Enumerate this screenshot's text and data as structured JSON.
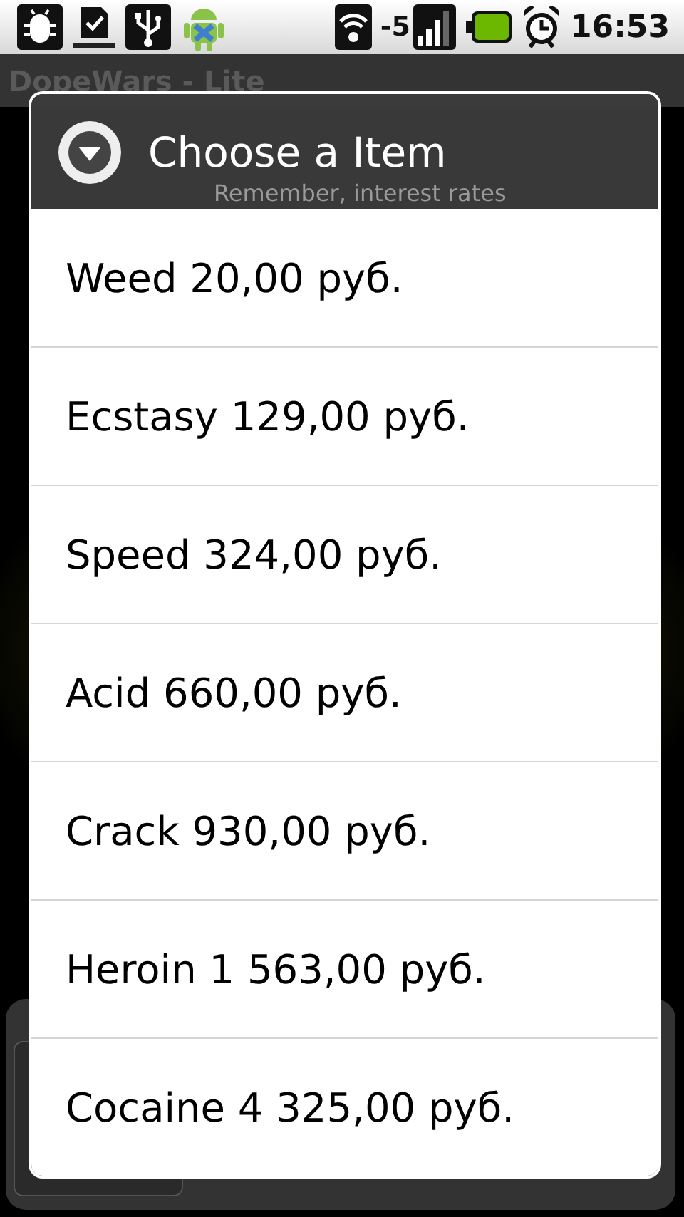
{
  "status_bar": {
    "signal_text": "-5",
    "time": "16:53"
  },
  "app_bar": {
    "title": "DopeWars - Lite"
  },
  "background": {
    "hint": "Remember, interest rates"
  },
  "dialog": {
    "title": "Choose a Item",
    "items": [
      {
        "label": "Weed 20,00 руб."
      },
      {
        "label": "Ecstasy 129,00 руб."
      },
      {
        "label": "Speed 324,00 руб."
      },
      {
        "label": "Acid 660,00 руб."
      },
      {
        "label": "Crack 930,00 руб."
      },
      {
        "label": "Heroin 1 563,00 руб."
      },
      {
        "label": "Cocaine 4 325,00 руб."
      }
    ]
  }
}
